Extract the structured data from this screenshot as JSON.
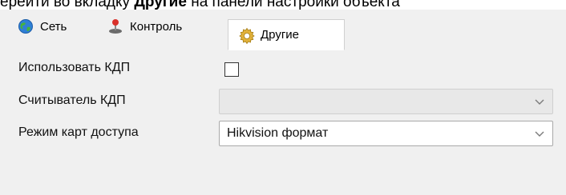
{
  "instruction": {
    "prefix": "ерейти во вкладку ",
    "bold": "Другие",
    "suffix": " на панели настройки объекта"
  },
  "tabs": [
    {
      "label": "Сеть",
      "icon": "globe-icon",
      "active": false
    },
    {
      "label": "Контроль",
      "icon": "joystick-icon",
      "active": false
    },
    {
      "label": "Другие",
      "icon": "gear-icon",
      "active": true
    }
  ],
  "form": {
    "use_kdp": {
      "label": "Использовать КДП",
      "checked": false
    },
    "reader": {
      "label": "Считыватель КДП",
      "value": "",
      "disabled": true
    },
    "card_mode": {
      "label": "Режим карт доступа",
      "value": "Hikvision формат",
      "disabled": false
    }
  }
}
